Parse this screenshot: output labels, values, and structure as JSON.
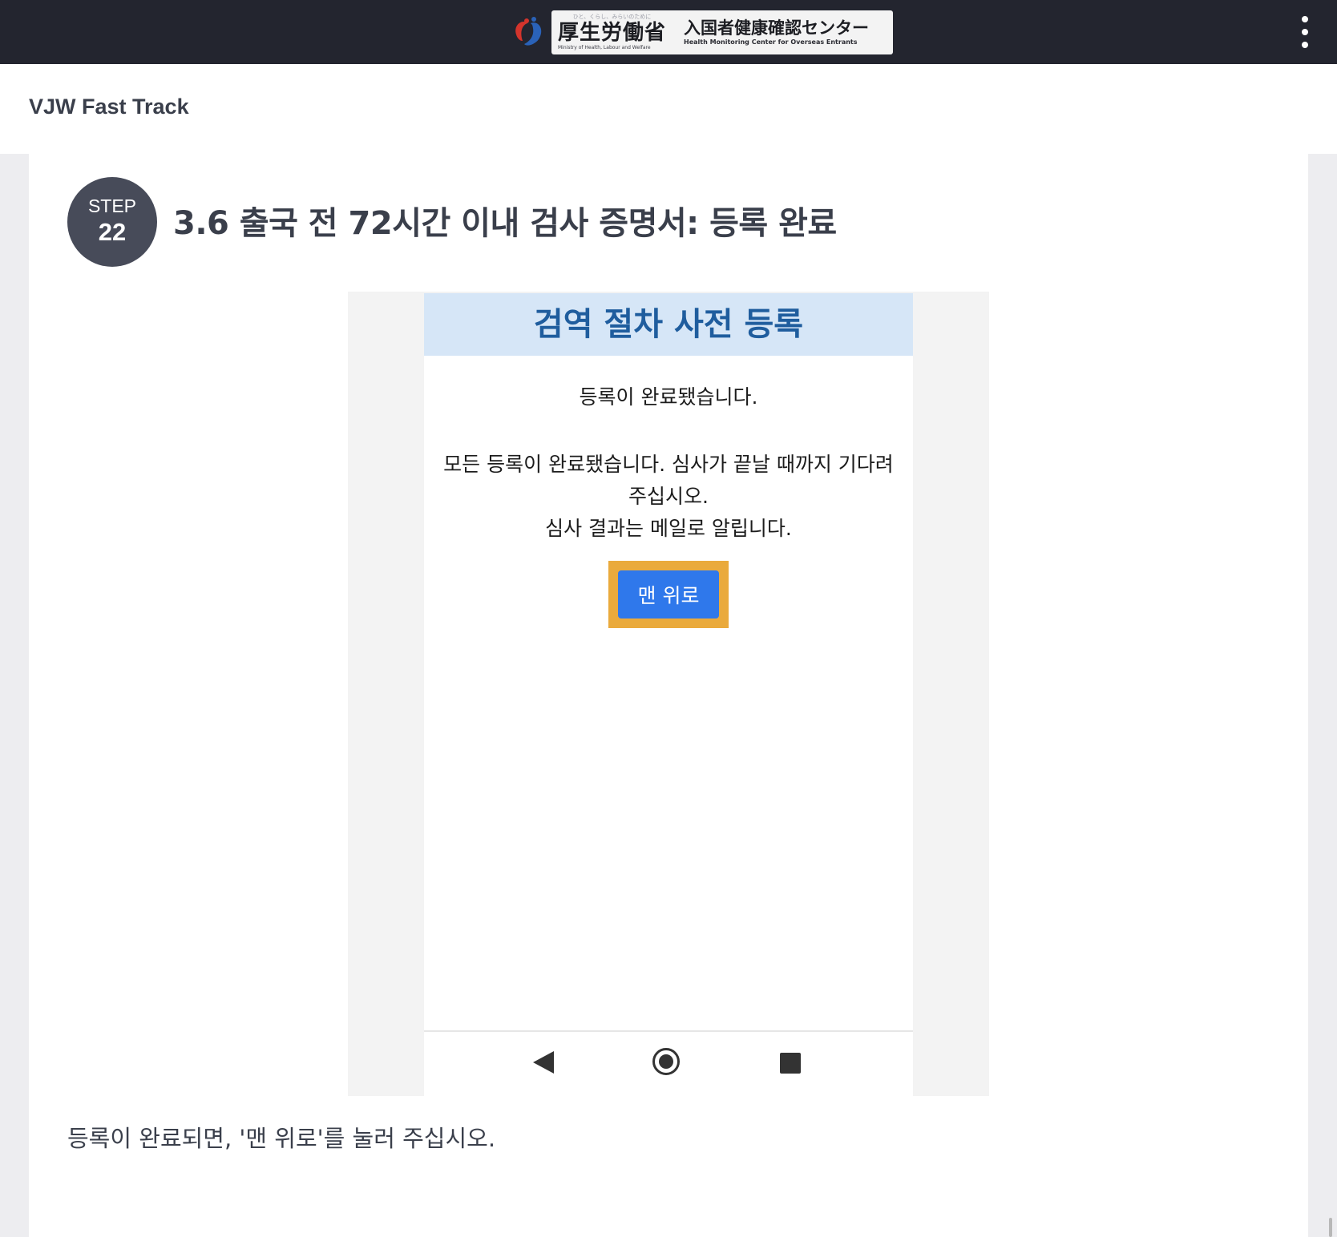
{
  "header": {
    "logo": {
      "tagline": "ひと、くらし、みらいのために",
      "ministry_ja": "厚生労働省",
      "ministry_en": "Ministry of Health, Labour and Welfare",
      "center_ja": "入国者健康確認センター",
      "center_en": "Health Monitoring Center for Overseas Entrants"
    },
    "menu_icon": "more-vert-icon"
  },
  "subheader": {
    "title": "VJW Fast Track"
  },
  "step": {
    "label": "STEP",
    "number": "22",
    "title": "3.6 출국 전 72시간 이내 검사 증명서: 등록 완료"
  },
  "phone_screen": {
    "header_title": "검역 절차 사전 등록",
    "message_title": "등록이 완료됐습니다.",
    "message_body": "모든 등록이 완료됐습니다. 심사가 끝날 때까지 기다려 주십시오.",
    "message_result": "심사 결과는 메일로 알립니다.",
    "top_button_label": "맨 위로",
    "nav_icons": [
      "back-icon",
      "home-icon",
      "recent-apps-icon"
    ]
  },
  "instruction": "등록이 완료되면, '맨 위로'를 눌러 주십시오.",
  "colors": {
    "topbar": "#23252f",
    "step_badge": "#474b59",
    "phone_header_bg": "#d6e6f7",
    "phone_header_text": "#1f5d9e",
    "button": "#2f78eb",
    "highlight": "#eaaa3c"
  }
}
